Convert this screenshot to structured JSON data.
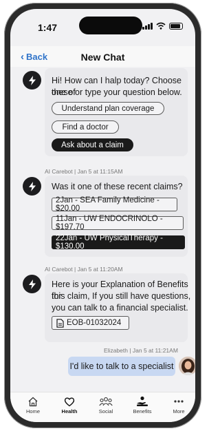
{
  "status": {
    "time": "1:47"
  },
  "nav": {
    "back_label": "Back",
    "title": "New Chat"
  },
  "messages": {
    "m1": {
      "lines": [
        "Hi! How can I halp today? Choose one of",
        "these or type your question below."
      ],
      "chips": [
        "Understand plan coverage",
        "Find a doctor",
        "Ask about a claim"
      ],
      "selected_chip": "Ask about a claim"
    },
    "m2": {
      "meta": "AI Carebot | Jan 5 at 11:15AM",
      "question": "Was it one of these recent claims?",
      "claims": [
        "2Jan - SEA Family Medicine - $20.00",
        "11Jan - UW ENDOCRINOLO - $197.70",
        "22Jan - UW PhysicalTherapy - $130.00"
      ]
    },
    "m3": {
      "meta": "AI Carebot | Jan 5 at 11:20AM",
      "lines": [
        "Here is your Explanation of Benefits for",
        "this claim, If you still have questions,",
        "you can talk to a financial specialist."
      ],
      "attachment": "EOB-01032024"
    },
    "m4": {
      "meta": "Elizabeth | Jan 5 at 11:21AM",
      "text": "I'd like to talk to a specialist"
    }
  },
  "tabs": {
    "home": "Home",
    "health": "Health",
    "social": "Social",
    "benefits": "Benefits",
    "more": "More"
  },
  "colors": {
    "accent": "#2f73c9",
    "user_bubble": "#c8d8f2",
    "bot_bubble": "#e9e9ec",
    "dark": "#1a1a1a"
  }
}
